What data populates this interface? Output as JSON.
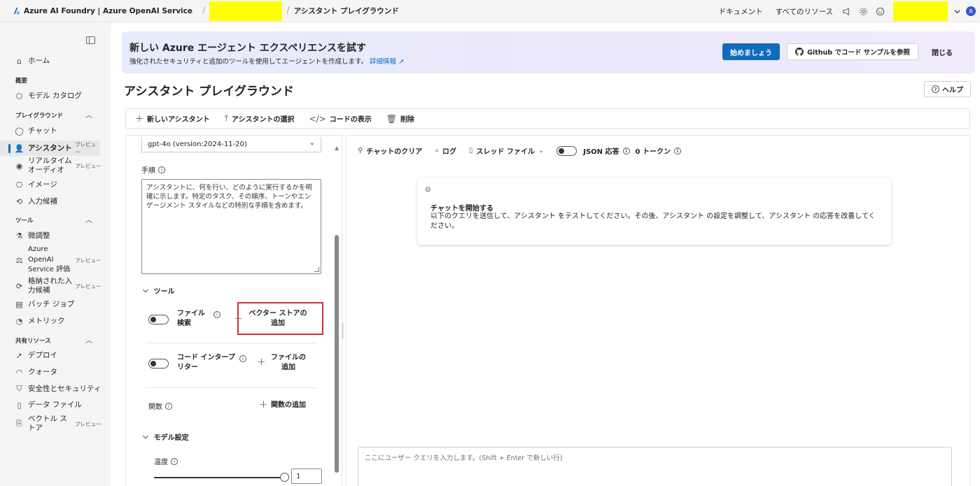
{
  "topbar": {
    "brand": "Azure AI Foundry | Azure OpenAI Service",
    "page": "アシスタント プレイグラウンド",
    "docs": "ドキュメント",
    "all_resources": "すべてのリソース",
    "avatar_initial": "R",
    "icons": [
      "megaphone-icon",
      "gear-icon",
      "smiley-icon",
      "chevron-down-icon"
    ]
  },
  "sidebar": {
    "home": "ホーム",
    "overview_header": "概要",
    "model_catalog": "モデル カタログ",
    "playground_header": "プレイグラウンド",
    "chat": "チャット",
    "assistant": "アシスタント",
    "realtime_audio": "リアルタイム オーディオ",
    "image": "イメージ",
    "completions": "入力候補",
    "tools_header": "ツール",
    "fine_tuning": "微調整",
    "evaluation": "Azure OpenAI Service 評価",
    "stored_completions": "格納された入力候補",
    "batch_jobs": "バッチ ジョブ",
    "metrics": "メトリック",
    "shared_header": "共有リソース",
    "deploy": "デプロイ",
    "quota": "クォータ",
    "safety": "安全性とセキュリティ",
    "data_files": "データ ファイル",
    "vector_store": "ベクトル ストア",
    "preview_badge": "プレビュー"
  },
  "banner": {
    "title": "新しい Azure エージェント エクスペリエンスを試す",
    "subtitle": "強化されたセキュリティと追加のツールを使用してエージェントを作成します。",
    "more": "詳細情報",
    "start": "始めましょう",
    "github": "Github でコード サンプルを参照",
    "close": "閉じる"
  },
  "page": {
    "title": "アシスタント プレイグラウンド",
    "help": "ヘルプ"
  },
  "toolbar": {
    "new_assistant": "新しいアシスタント",
    "select_assistant": "アシスタントの選択",
    "view_code": "コードの表示",
    "delete": "削除"
  },
  "setup": {
    "model": "gpt-4o (version:2024-11-20)",
    "instructions_label": "手順",
    "instructions_text": "アシスタントに、何を行い、どのように実行するかを明確に示します。特定のタスク、その順序、トーンやエンゲージメント スタイルなどの特別な手順を含めます。",
    "tools_header": "ツール",
    "file_search_line1": "ファイル",
    "file_search_line2": "検索",
    "add_vector_line1": "ベクター ストアの",
    "add_vector_line2": "追加",
    "code_interp_line1": "コード インタープ",
    "code_interp_line2": "リター",
    "add_file_line1": "ファイルの",
    "add_file_line2": "追加",
    "functions": "関数",
    "add_function": "関数の追加",
    "model_settings": "モデル設定",
    "temperature": "温度",
    "temperature_value": "1",
    "temperature_fraction": 1.0
  },
  "chat": {
    "clear": "チャットのクリア",
    "log": "ログ",
    "thread_files": "スレッド ファイル",
    "json_response": "JSON 応答",
    "tokens": "0 トークン",
    "start_title": "チャットを開始する",
    "start_desc": "以下のクエリを送信して、アシスタント をテストしてください。その後、アシスタント の設定を調整して、アシスタント の応答を改善してください。",
    "input_placeholder": "ここにユーザー クエリを入力します。(Shift + Enter で新しい行)"
  }
}
